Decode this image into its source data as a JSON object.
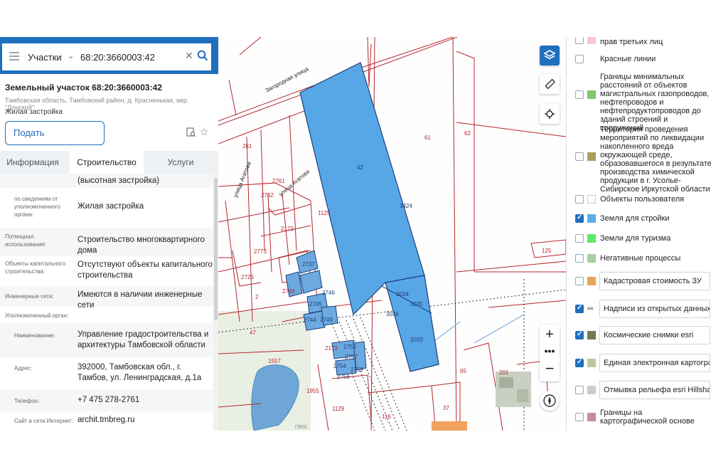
{
  "search": {
    "type": "Участки",
    "value": "68:20:3660003:42"
  },
  "parcel": {
    "title": "Земельный участок 68:20:3660003:42",
    "address": "Тамбовская область, Тамбовский район, д. Красненькая, мкр. \"Донской\"",
    "type": "Жилая застройка",
    "submit_label": "Подать обращение→"
  },
  "tabs": [
    "Информация",
    "Строительство",
    "Услуги"
  ],
  "details": [
    {
      "label": "",
      "value": "(высотная застройка)"
    },
    {
      "label": "по сведениям от уполномоченного органа:",
      "value": "Жилая застройка"
    },
    {
      "label": "Потенциал использования:",
      "value": "Строительство многоквартирного дома"
    },
    {
      "label": "Объекты капитального строительства:",
      "value": "Отсутствуют объекты капитального строительства"
    },
    {
      "label": "Инженерные сети:",
      "value": "Имеются в наличии инженерные сети"
    },
    {
      "label": "Уполномоченный орган:",
      "value": ""
    },
    {
      "label": "Наименование:",
      "value": "Управление градостроительства и архитектуры Тамбовской области"
    },
    {
      "label": "Адрес:",
      "value": "392000, Тамбовская обл., г. Тамбов, ул. Ленинградская, д.1а"
    },
    {
      "label": "Телефон:",
      "value": "+7 475 278-2761"
    },
    {
      "label": "Сайт в сети Интернет:",
      "value": "archit.tmbreg.ru"
    }
  ],
  "map": {
    "labels": {
      "parcel42": "42",
      "p1129a": "1129",
      "p1129b": "1129",
      "p2172": "2172",
      "p2773": "2773",
      "p61": "61",
      "p62": "62",
      "p3424": "3424",
      "p3034": "3034",
      "p3035": "3035",
      "p3033": "3033",
      "p3036": "3036",
      "p2": "2",
      "p47": "47",
      "p1557": "1557",
      "p1955": "1955",
      "p116": "116",
      "p37": "37",
      "p65": "65",
      "p201": "201",
      "p2761": "2761",
      "p2762": "2762",
      "p2737": "2737",
      "p2745": "2745",
      "p2746": "2746",
      "p2749": "2749",
      "p2744": "2744",
      "p2173": "2173",
      "p2754": "2754",
      "p2756": "2756",
      "p2753": "2753",
      "p2757": "2757",
      "p2759": "2759",
      "p2726": "2726",
      "p2765": "2765",
      "p125": "125",
      "p261": "261",
      "street1": "Загородная улица",
      "street2": "улица Агатова",
      "street3": "улица Агатова"
    },
    "attribution": "ГВКС"
  },
  "layers": [
    {
      "name": "прав третьих лиц",
      "checked": false,
      "color": "#f5c6d6",
      "boxed": false
    },
    {
      "name": "Красные линии",
      "checked": false,
      "color": "",
      "boxed": false
    },
    {
      "name": "Границы минимальных расстояний от объектов магистральных газопроводов, нефтепроводов и нефтепродуктопроводов до зданий строений и сооружений",
      "checked": false,
      "color": "#7cc96a",
      "boxed": false
    },
    {
      "name": "Территория проведения мероприятий по ликвидации накопленного вреда окружающей среде, образовавшегося в результате производства химической продукции в г. Усолье-Сибирское Иркутской области",
      "checked": false,
      "color": "#a8a15a",
      "boxed": false
    },
    {
      "name": "Объекты пользователя",
      "checked": false,
      "color": "",
      "boxed": false
    },
    {
      "name": "Земля для стройки",
      "checked": true,
      "color": "#5aaee8",
      "boxed": false
    },
    {
      "name": "Земли для туризма",
      "checked": false,
      "color": "#5ee86a",
      "boxed": false
    },
    {
      "name": "Негативные процессы",
      "checked": false,
      "color": "#a7cfa0",
      "boxed": false
    },
    {
      "name": "Кадастровая стоимость ЗУ",
      "checked": false,
      "color": "#e7a45c",
      "boxed": true
    },
    {
      "name": "Надписи из открытых данных",
      "checked": true,
      "color": "#777777",
      "boxed": true
    },
    {
      "name": "Космические снимки esri",
      "checked": true,
      "color": "#6c7a55",
      "boxed": true
    },
    {
      "name": "Единая электронная картогра...",
      "checked": true,
      "color": "#b9c99a",
      "boxed": true
    },
    {
      "name": "Отмывка рельефа esri Hillshade",
      "checked": false,
      "color": "#cccccc",
      "boxed": true
    },
    {
      "name": "Границы на картографической основе",
      "checked": false,
      "color": "#c58aa8",
      "boxed": false
    }
  ]
}
